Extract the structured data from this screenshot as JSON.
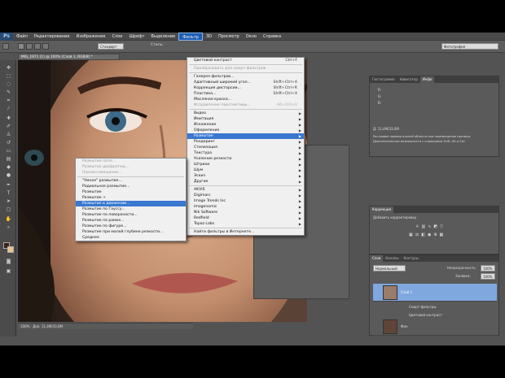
{
  "app": {
    "logo": "Ps",
    "menu": [
      "Файл",
      "Редактирование",
      "Изображение",
      "Слои",
      "Шрифт",
      "Выделение",
      "Фильтр",
      "3D",
      "Просмотр",
      "Окно",
      "Справка"
    ],
    "active_menu": "Фильтр"
  },
  "options_bar": {
    "mode_value": "Стандарт",
    "style_label": "Стиль:",
    "workspace": "Фотография",
    "tolerance_label": "Стиль:"
  },
  "document": {
    "tab_title": "IMG_1971 (1) @ 100% (Слой 1, RGB/8) *",
    "status": "Док: 11,4M/33,0M",
    "zoom": "100%"
  },
  "filter_menu": {
    "items": [
      {
        "label": "Цветовой контраст",
        "shortcut": "Ctrl+F",
        "state": "normal"
      },
      {
        "sep": true
      },
      {
        "label": "Преобразовать для смарт-фильтров",
        "state": "disabled"
      },
      {
        "sep": true
      },
      {
        "label": "Галерея фильтров...",
        "state": "normal"
      },
      {
        "label": "Адаптивный широкий угол...",
        "shortcut": "Shift+Ctrl+A",
        "state": "normal"
      },
      {
        "label": "Коррекция дисторсии...",
        "shortcut": "Shift+Ctrl+R",
        "state": "normal"
      },
      {
        "label": "Пластика...",
        "shortcut": "Shift+Ctrl+X",
        "state": "normal"
      },
      {
        "label": "Масляная краска...",
        "state": "normal"
      },
      {
        "label": "Исправление перспективы...",
        "shortcut": "Alt+Ctrl+V",
        "state": "disabled"
      },
      {
        "sep": true
      },
      {
        "label": "Видео",
        "submenu": true,
        "state": "normal"
      },
      {
        "label": "Имитация",
        "submenu": true,
        "state": "normal"
      },
      {
        "label": "Искажение",
        "submenu": true,
        "state": "normal"
      },
      {
        "label": "Оформление",
        "submenu": true,
        "state": "normal"
      },
      {
        "label": "Размытие",
        "submenu": true,
        "state": "highlighted"
      },
      {
        "label": "Рендеринг",
        "submenu": true,
        "state": "normal"
      },
      {
        "label": "Стилизация",
        "submenu": true,
        "state": "normal"
      },
      {
        "label": "Текстура",
        "submenu": true,
        "state": "normal"
      },
      {
        "label": "Усиление резкости",
        "submenu": true,
        "state": "normal"
      },
      {
        "label": "Штрихи",
        "submenu": true,
        "state": "normal"
      },
      {
        "label": "Шум",
        "submenu": true,
        "state": "normal"
      },
      {
        "label": "Эскиз",
        "submenu": true,
        "state": "normal"
      },
      {
        "label": "Другие",
        "submenu": true,
        "state": "normal"
      },
      {
        "sep": true
      },
      {
        "label": "AKVIS",
        "submenu": true,
        "state": "normal"
      },
      {
        "label": "Digimarc",
        "submenu": true,
        "state": "normal"
      },
      {
        "label": "Image Trends Inc",
        "submenu": true,
        "state": "normal"
      },
      {
        "label": "Imagenomic",
        "submenu": true,
        "state": "normal"
      },
      {
        "label": "Nik Software",
        "submenu": true,
        "state": "normal"
      },
      {
        "label": "Redfield",
        "submenu": true,
        "state": "normal"
      },
      {
        "label": "Topaz Labs",
        "submenu": true,
        "state": "normal"
      },
      {
        "sep": true
      },
      {
        "label": "Найти фильтры в Интернете...",
        "state": "normal"
      }
    ]
  },
  "blur_submenu": {
    "items": [
      {
        "label": "Размытие поля...",
        "state": "disabled"
      },
      {
        "label": "Размытие диафрагмы...",
        "state": "disabled"
      },
      {
        "label": "Наклон-смещение...",
        "state": "disabled"
      },
      {
        "sep": true
      },
      {
        "label": "\"Умное\" размытие...",
        "state": "normal"
      },
      {
        "label": "Радиальное размытие...",
        "state": "normal"
      },
      {
        "label": "Размытие",
        "state": "normal"
      },
      {
        "label": "Размытие +",
        "state": "normal"
      },
      {
        "label": "Размытие в движении...",
        "state": "highlighted"
      },
      {
        "label": "Размытие по Гауссу...",
        "state": "normal"
      },
      {
        "label": "Размытие по поверхности...",
        "state": "normal"
      },
      {
        "label": "Размытие по рамке...",
        "state": "normal"
      },
      {
        "label": "Размытие по фигуре...",
        "state": "normal"
      },
      {
        "label": "Размытие при малой глубине резкости...",
        "state": "normal"
      },
      {
        "label": "Среднее",
        "state": "normal"
      }
    ]
  },
  "panels": {
    "top_tabs": [
      "Гистограмма",
      "Навигатор",
      "Инфо"
    ],
    "info_line1": "Д: 11,4M/33,0M",
    "info_line2": "Растровое прямоугольной области или перемещение границы",
    "info_line3": "Дополнительные возможности с клавишами Shift, Alt и Ctrl.",
    "corrections_tab": "Коррекция",
    "corrections_title": "Добавить корректировку",
    "layers_tabs": [
      "Слои",
      "Каналы",
      "Контуры"
    ],
    "blend_mode": "Нормальный",
    "opacity_label": "Непрозрачность:",
    "opacity_value": "100%",
    "fill_label": "Заливка:",
    "fill_value": "100%",
    "layer_selected": "Слой 1",
    "layer_filters": "Смарт-фильтры",
    "layer_filter_item": "Цветовой контраст",
    "layer_bg": "Фон"
  },
  "colors": {
    "highlight": "#3a78d0",
    "menu_bg": "#f0f0f0",
    "ui_gray": "#535353"
  }
}
